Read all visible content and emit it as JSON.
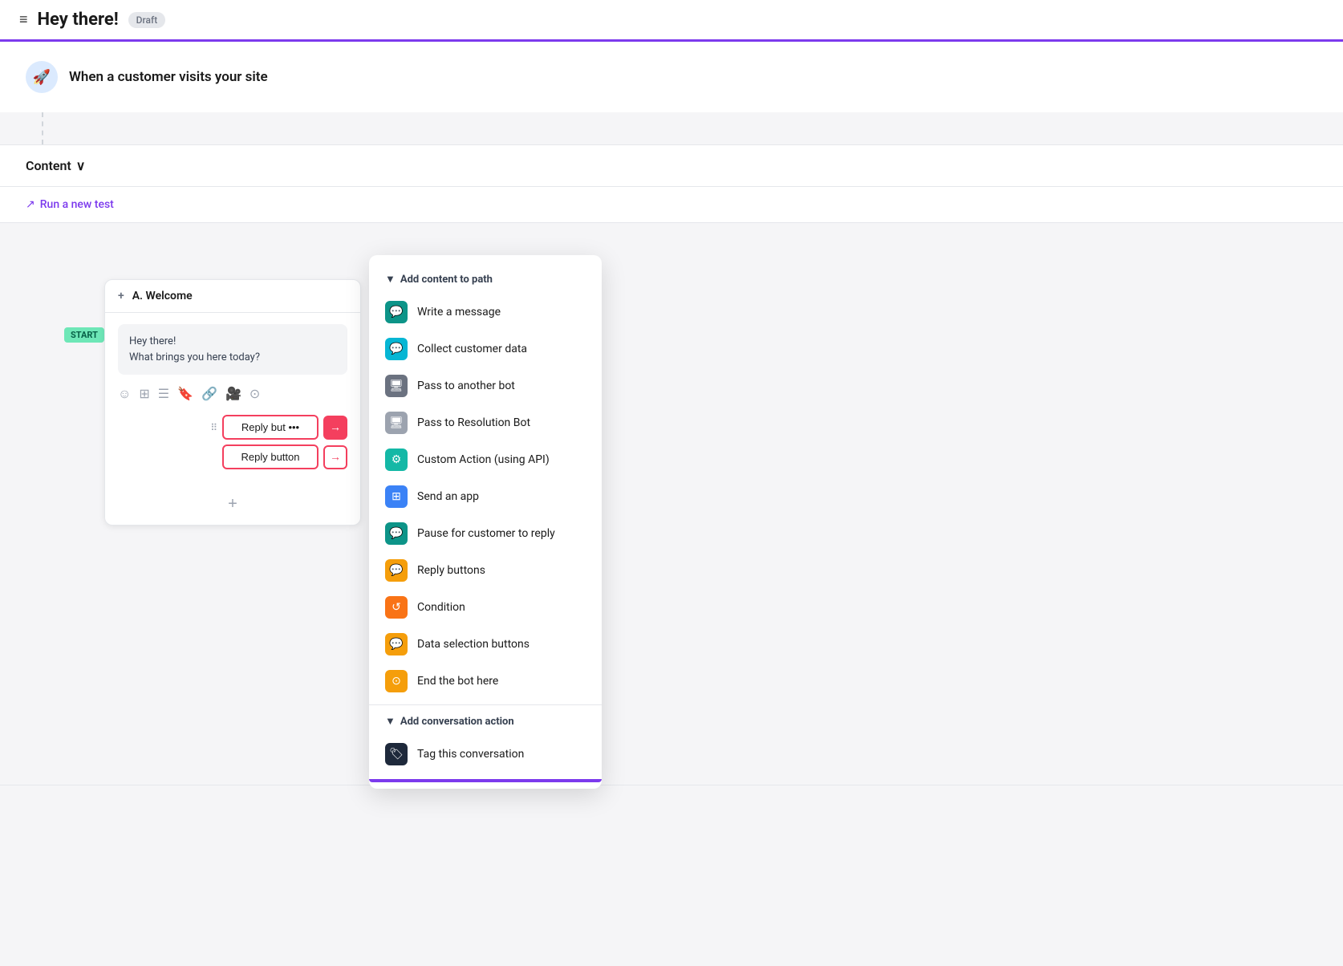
{
  "header": {
    "menu_icon": "≡",
    "title": "Hey there!",
    "badge": "Draft"
  },
  "trigger": {
    "icon": "🚀",
    "text": "When a customer visits your site"
  },
  "content_section": {
    "label": "Content",
    "caret": "∨",
    "run_test": "Run a new test"
  },
  "flow_card": {
    "plus": "+",
    "step_label": "A. Welcome",
    "message_line1": "Hey there!",
    "message_line2": "What brings you here today?",
    "toolbar_icons": [
      "☺",
      "⊞",
      "☰",
      "🔖",
      "🔗",
      "🎥",
      "⊙"
    ],
    "reply_button_1_text": "Reply but •••",
    "reply_button_2_text": "Reply button",
    "add_step": "+"
  },
  "start_badge": "START",
  "dropdown": {
    "section1_title": "Add content to path",
    "items": [
      {
        "icon": "💬",
        "icon_class": "icon-teal",
        "label": "Write a message"
      },
      {
        "icon": "💬",
        "icon_class": "icon-cyan",
        "label": "Collect customer data"
      },
      {
        "icon": "🖥",
        "icon_class": "icon-gray",
        "label": "Pass to another bot"
      },
      {
        "icon": "🖥",
        "icon_class": "icon-gray2",
        "label": "Pass to Resolution Bot"
      },
      {
        "icon": "⚙",
        "icon_class": "icon-teal2",
        "label": "Custom Action (using API)"
      },
      {
        "icon": "⊞",
        "icon_class": "icon-blue",
        "label": "Send an app"
      },
      {
        "icon": "💬",
        "icon_class": "icon-teal",
        "label": "Pause for customer to reply"
      },
      {
        "icon": "💬",
        "icon_class": "icon-yellow",
        "label": "Reply buttons"
      },
      {
        "icon": "↺",
        "icon_class": "icon-orange",
        "label": "Condition"
      },
      {
        "icon": "💬",
        "icon_class": "icon-yellow",
        "label": "Data selection buttons"
      },
      {
        "icon": "⊙",
        "icon_class": "icon-yellow",
        "label": "End the bot here"
      }
    ],
    "section2_title": "Add conversation action",
    "items2": [
      {
        "icon": "🏷",
        "icon_class": "icon-dark",
        "label": "Tag this conversation"
      }
    ]
  }
}
